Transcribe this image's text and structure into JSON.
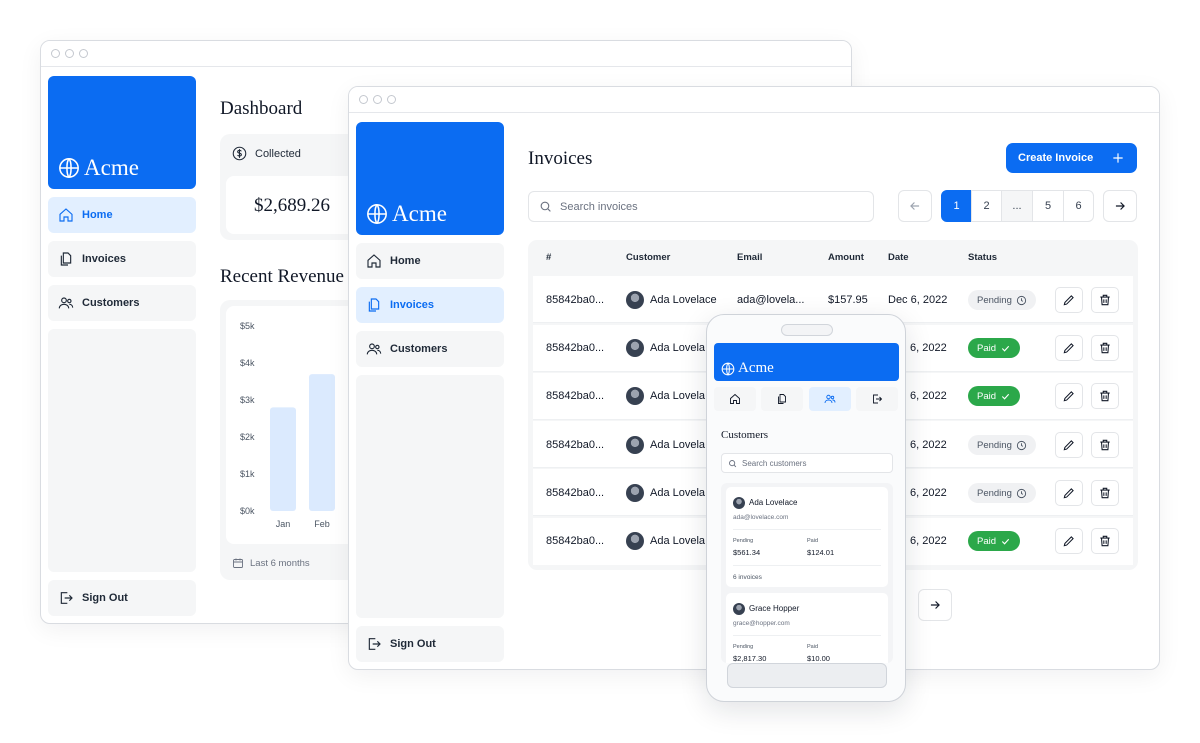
{
  "dashboard": {
    "brand": "Acme",
    "nav": [
      {
        "label": "Home",
        "icon": "home-icon"
      },
      {
        "label": "Invoices",
        "icon": "document-icon"
      },
      {
        "label": "Customers",
        "icon": "users-icon"
      }
    ],
    "sign_out": "Sign Out",
    "title": "Dashboard",
    "collected_label": "Collected",
    "collected_value": "$2,689.26",
    "revenue_title": "Recent Revenue",
    "last_months": "Last 6 months",
    "chart_data": {
      "type": "bar",
      "categories": [
        "Jan",
        "Feb"
      ],
      "values": [
        2800,
        3700
      ],
      "yticks": [
        "$5k",
        "$4k",
        "$3k",
        "$2k",
        "$1k",
        "$0k"
      ],
      "ylim": [
        0,
        5000
      ],
      "bar_color": "#dbeafe"
    }
  },
  "invoices": {
    "brand": "Acme",
    "nav": [
      {
        "label": "Home",
        "icon": "home-icon"
      },
      {
        "label": "Invoices",
        "icon": "document-icon"
      },
      {
        "label": "Customers",
        "icon": "users-icon"
      }
    ],
    "sign_out": "Sign Out",
    "title": "Invoices",
    "create_button": "Create Invoice",
    "search_placeholder": "Search invoices",
    "pagination": [
      "1",
      "2",
      "...",
      "5",
      "6"
    ],
    "columns": [
      "#",
      "Customer",
      "Email",
      "Amount",
      "Date",
      "Status"
    ],
    "rows": [
      {
        "id": "85842ba0...",
        "customer": "Ada Lovelace",
        "email": "ada@lovela...",
        "amount": "$157.95",
        "date": "Dec 6, 2022",
        "status": "Pending"
      },
      {
        "id": "85842ba0...",
        "customer": "Ada Lovela",
        "date": "6, 2022",
        "status": "Paid"
      },
      {
        "id": "85842ba0...",
        "customer": "Ada Lovela",
        "date": "6, 2022",
        "status": "Paid"
      },
      {
        "id": "85842ba0...",
        "customer": "Ada Lovela",
        "date": "6, 2022",
        "status": "Pending"
      },
      {
        "id": "85842ba0...",
        "customer": "Ada Lovela",
        "date": "6, 2022",
        "status": "Pending"
      },
      {
        "id": "85842ba0...",
        "customer": "Ada Lovela",
        "date": "6, 2022",
        "status": "Paid"
      }
    ],
    "accent": "#0b6cf2",
    "paid_color": "#2ba84a"
  },
  "mobile": {
    "brand": "Acme",
    "title": "Customers",
    "search_placeholder": "Search customers",
    "customers": [
      {
        "name": "Ada Lovelace",
        "email": "ada@lovelace.com",
        "pending_label": "Pending",
        "pending": "$561.34",
        "paid_label": "Paid",
        "paid": "$124.01",
        "invoices": "6 invoices"
      },
      {
        "name": "Grace Hopper",
        "email": "grace@hopper.com",
        "pending_label": "Pending",
        "pending": "$2,817.30",
        "paid_label": "Paid",
        "paid": "$10.00"
      }
    ]
  }
}
